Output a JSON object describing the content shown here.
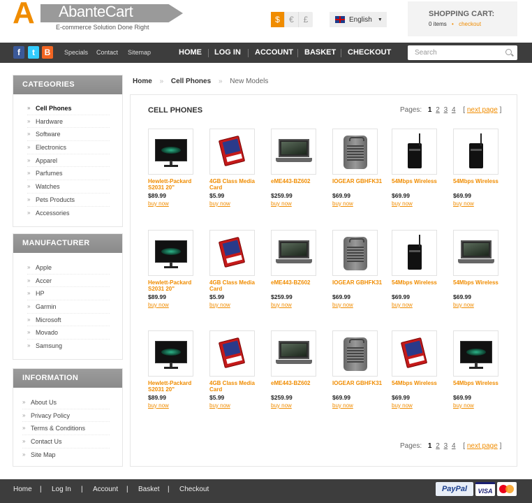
{
  "header": {
    "logo_letter": "A",
    "logo_name": "AbanteCart",
    "logo_tagline": "E-commerce Solution Done Right",
    "currencies": [
      "$",
      "€",
      "£"
    ],
    "language": "English",
    "cart_title": "SHOPPING CART:",
    "cart_items": "0 items",
    "cart_dot": "•",
    "cart_checkout": "checkout"
  },
  "nav": {
    "social": [
      "f",
      "t",
      "B"
    ],
    "top_links": [
      "Specials",
      "Contact",
      "Sitemap"
    ],
    "main_links": [
      "HOME",
      "LOG IN",
      "ACCOUNT",
      "BASKET",
      "CHECKOUT"
    ],
    "search_placeholder": "Search"
  },
  "sidebar": {
    "categories_title": "CATEGORIES",
    "categories": [
      "Cell Phones",
      "Hardware",
      "Software",
      "Electronics",
      "Apparel",
      "Parfumes",
      "Watches",
      "Pets Products",
      "Accessories"
    ],
    "manufacturer_title": "MANUFACTURER",
    "manufacturers": [
      "Apple",
      "Accer",
      "HP",
      "Garmin",
      "Microsoft",
      "Movado",
      "Samsung"
    ],
    "information_title": "INFORMATION",
    "information": [
      "About Us",
      "Privacy Policy",
      "Terms & Conditions",
      "Contact Us",
      "Site Map"
    ]
  },
  "breadcrumb": {
    "home": "Home",
    "sep": "»",
    "category": "Cell Phones",
    "current": "New Models"
  },
  "main": {
    "title": "CELL PHONES",
    "pages_label": "Pages:",
    "pages": [
      "1",
      "2",
      "3",
      "4"
    ],
    "bracket_open": "[",
    "next_page": "next page",
    "bracket_close": "]",
    "buy_now": "buy now",
    "products": [
      [
        {
          "name": "Hewlett-Packard S2031 20\"",
          "price": "$89.99",
          "img": "monitor"
        },
        {
          "name": "4GB Class Media Card",
          "price": "$5.99",
          "img": "sdcard"
        },
        {
          "name": "eME443-BZ602",
          "price": "$259.99",
          "img": "laptop"
        },
        {
          "name": "IOGEAR GBHFK31",
          "price": "$69.99",
          "img": "device"
        },
        {
          "name": "54Mbps Wireless",
          "price": "$69.99",
          "img": "router"
        },
        {
          "name": "54Mbps Wireless",
          "price": "$69.99",
          "img": "router"
        }
      ],
      [
        {
          "name": "Hewlett-Packard S2031 20\"",
          "price": "$89.99",
          "img": "monitor"
        },
        {
          "name": "4GB Class Media Card",
          "price": "$5.99",
          "img": "sdcard"
        },
        {
          "name": "eME443-BZ602",
          "price": "$259.99",
          "img": "laptop"
        },
        {
          "name": "IOGEAR GBHFK31",
          "price": "$69.99",
          "img": "device"
        },
        {
          "name": "54Mbps Wireless",
          "price": "$69.99",
          "img": "router"
        },
        {
          "name": "54Mbps Wireless",
          "price": "$69.99",
          "img": "laptop"
        }
      ],
      [
        {
          "name": "Hewlett-Packard S2031 20\"",
          "price": "$89.99",
          "img": "monitor"
        },
        {
          "name": "4GB Class Media Card",
          "price": "$5.99",
          "img": "sdcard"
        },
        {
          "name": "eME443-BZ602",
          "price": "$259.99",
          "img": "laptop"
        },
        {
          "name": "IOGEAR GBHFK31",
          "price": "$69.99",
          "img": "device"
        },
        {
          "name": "54Mbps Wireless",
          "price": "$69.99",
          "img": "sdcard"
        },
        {
          "name": "54Mbps Wireless",
          "price": "$69.99",
          "img": "monitor"
        }
      ]
    ]
  },
  "footer": {
    "links": [
      "Home",
      "Log In",
      "Account",
      "Basket",
      "Checkout"
    ],
    "sep": "|",
    "payments": [
      "PayPal",
      "VISA",
      "MasterCard"
    ]
  }
}
